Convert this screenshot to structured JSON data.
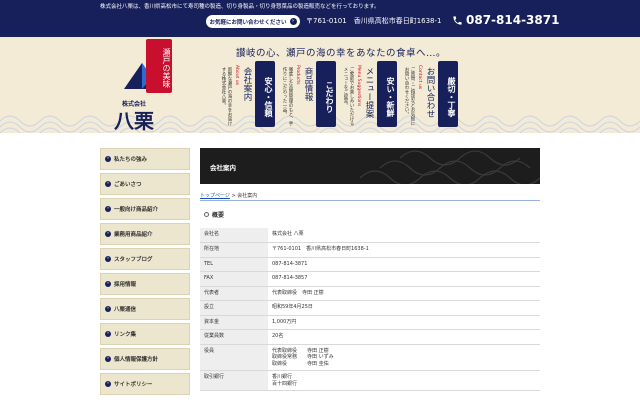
{
  "topbar": {
    "tagline": "株式会社八栗は、香川県高松市にて寿司種の製造、切り身製品・切り身惣菜品の製造販売などを行っております。",
    "contact_label": "お気軽にお問い合わせください",
    "address": "〒761-0101　香川県高松市春日町1638-1",
    "phone": "087-814-3871"
  },
  "header": {
    "catchphrase": "讃岐の心、瀬戸の海の幸をあなたの食卓へ…。",
    "logo": {
      "seal_text": "瀬戸の美味",
      "company_sub": "株式会社",
      "company_name": "八栗"
    },
    "nav": [
      {
        "tag": "安心・信頼",
        "title": "会社案内",
        "en": "About us",
        "desc": "新鮮な瀬戸の海の幸をお届けする株式会社八栗。"
      },
      {
        "tag": "こだわり",
        "title": "商品情報",
        "en": "Products",
        "desc": "徹底した品質管理のもと、手作りにこだわった一品。"
      },
      {
        "tag": "安い・新鮮",
        "title": "メニュー提案",
        "en": "Menu Suggestions",
        "desc": "ご家庭でお楽しみいただけるメニューをご提案。"
      },
      {
        "tag": "厳切・丁寧",
        "title": "お問い合わせ",
        "en": "Contact us",
        "desc": "ご質問・ご相談などお気軽にお問い合わせください。"
      }
    ]
  },
  "sidebar": {
    "items": [
      {
        "label": "私たちの強み"
      },
      {
        "label": "ごあいさつ"
      },
      {
        "label": "一般向け商品紹介"
      },
      {
        "label": "業務用商品紹介"
      },
      {
        "label": "スタッフブログ"
      },
      {
        "label": "採用情報"
      },
      {
        "label": "八栗通信"
      },
      {
        "label": "リンク集"
      },
      {
        "label": "個人情報保護方針"
      },
      {
        "label": "サイトポリシー"
      }
    ]
  },
  "main": {
    "page_title": "会社案内",
    "breadcrumb": {
      "home": "トップページ",
      "separator": ">",
      "current": "会社案内"
    },
    "section_title": "概要",
    "rows": [
      {
        "key": "会社名",
        "value": "株式会社 八栗"
      },
      {
        "key": "所在地",
        "value": "〒761-0101　香川県高松市春日町1638-1"
      },
      {
        "key": "TEL",
        "value": "087-814-3871"
      },
      {
        "key": "FAX",
        "value": "087-814-3857"
      },
      {
        "key": "代表者",
        "value": "代表取締役　寺田 正樹"
      },
      {
        "key": "設立",
        "value": "昭和59年4月25日"
      },
      {
        "key": "資本金",
        "value": "1,000万円"
      },
      {
        "key": "従業員数",
        "value": "20名"
      },
      {
        "key": "役員",
        "lines": [
          "代表取締役　　寺田 正樹",
          "取締役常務　　寺田 いずみ",
          "取締役　　　　寺田 圭佑"
        ]
      },
      {
        "key": "取引銀行",
        "lines": [
          "香川銀行",
          "百十四銀行"
        ]
      }
    ]
  },
  "colors": {
    "navy": "#17205a",
    "red": "#c8102e",
    "cream": "#f3ebd6",
    "dark": "#1d1d1d",
    "link": "#1a4fb3"
  }
}
